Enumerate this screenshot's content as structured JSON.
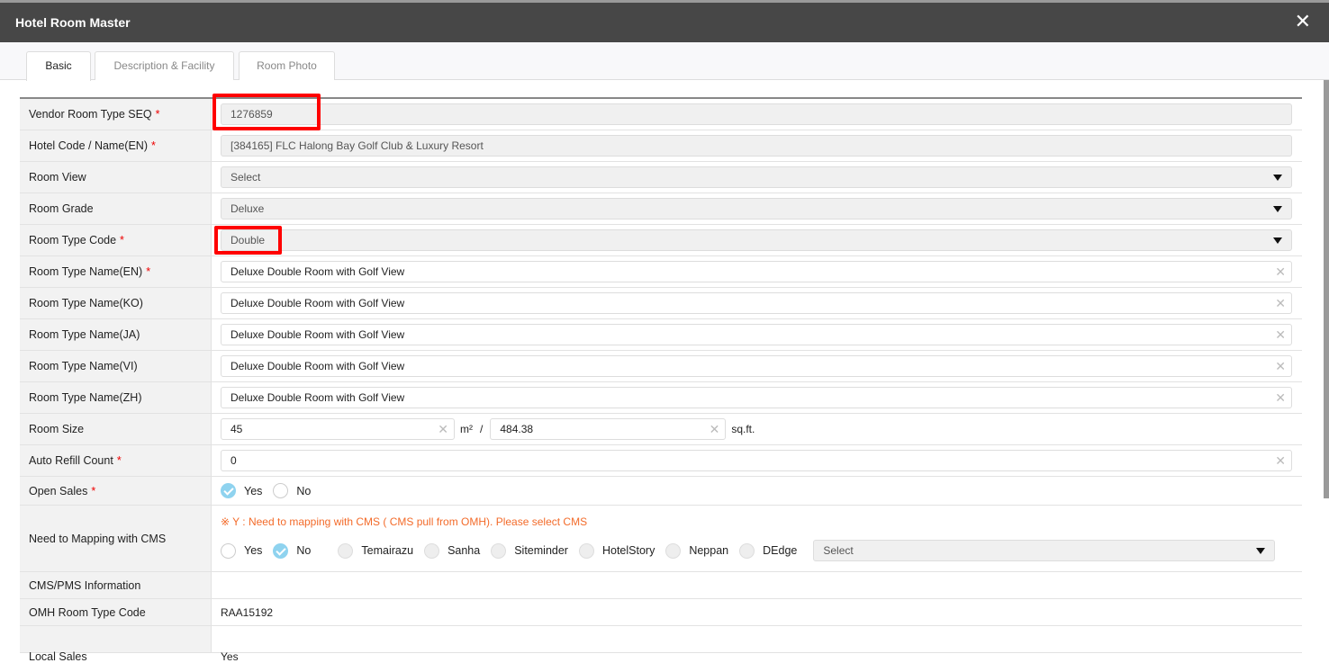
{
  "modal": {
    "title": "Hotel Room Master",
    "close": "✕"
  },
  "tabs": [
    {
      "label": "Basic"
    },
    {
      "label": "Description & Facility"
    },
    {
      "label": "Room Photo"
    }
  ],
  "fields": {
    "vendor_seq": {
      "label": "Vendor Room Type SEQ",
      "value": "1276859"
    },
    "hotel": {
      "label": "Hotel Code / Name(EN)",
      "value": "[384165] FLC Halong Bay Golf Club & Luxury Resort"
    },
    "room_view": {
      "label": "Room View",
      "value": "Select"
    },
    "room_grade": {
      "label": "Room Grade",
      "value": "Deluxe"
    },
    "room_type_code": {
      "label": "Room Type Code",
      "value": "Double"
    },
    "name_en": {
      "label": "Room Type Name(EN)",
      "value": "Deluxe Double Room with Golf View"
    },
    "name_ko": {
      "label": "Room Type Name(KO)",
      "value": "Deluxe Double Room with Golf View"
    },
    "name_ja": {
      "label": "Room Type Name(JA)",
      "value": "Deluxe Double Room with Golf View"
    },
    "name_vi": {
      "label": "Room Type Name(VI)",
      "value": "Deluxe Double Room with Golf View"
    },
    "name_zh": {
      "label": "Room Type Name(ZH)",
      "value": "Deluxe Double Room with Golf View"
    },
    "room_size": {
      "label": "Room Size",
      "m2": "45",
      "m2_unit": "m²",
      "sep": "/",
      "sqft": "484.38",
      "sqft_unit": "sq.ft."
    },
    "auto_refill": {
      "label": "Auto Refill Count",
      "value": "0"
    },
    "open_sales": {
      "label": "Open Sales",
      "yes": "Yes",
      "no": "No",
      "selected": "Yes"
    },
    "cms": {
      "label": "Need to Mapping with CMS",
      "note": "※ Y : Need to mapping with CMS ( CMS pull from OMH). Please select CMS",
      "yes": "Yes",
      "no": "No",
      "selected": "No",
      "options": [
        "Temairazu",
        "Sanha",
        "Siteminder",
        "HotelStory",
        "Neppan",
        "DEdge"
      ],
      "select": "Select"
    },
    "cms_pms": {
      "label": "CMS/PMS Information"
    },
    "omh_code": {
      "label": "OMH Room Type Code",
      "value": "RAA15192"
    },
    "local_sales": {
      "label": "Local Sales",
      "value": "Yes"
    }
  },
  "required_mark": "*"
}
